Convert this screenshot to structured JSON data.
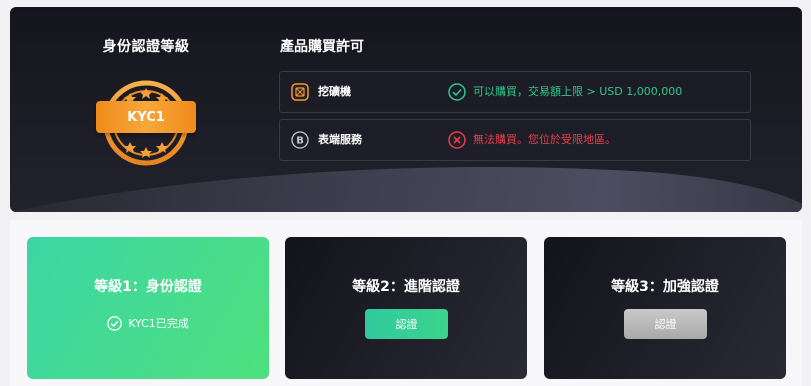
{
  "kyc": {
    "title": "身份認證等級",
    "badge_label": "KYC1"
  },
  "permissions": {
    "title": "產品購買許可",
    "items": [
      {
        "name": "挖礦機",
        "icon": "mining-machine-icon",
        "status": "ok",
        "status_icon": "check-circle-icon",
        "status_text": "可以購買，交易額上限 > USD 1,000,000"
      },
      {
        "name": "表端服務",
        "icon": "bitcoin-icon",
        "status": "blocked",
        "status_icon": "x-circle-icon",
        "status_text": "無法購買。您位於受限地區。"
      }
    ]
  },
  "levels": [
    {
      "title": "等級1：身份認證",
      "done_text": "KYC1已完成",
      "done_icon": "check-circle-icon"
    },
    {
      "title": "等級2：進階認證",
      "button_label": "認證"
    },
    {
      "title": "等級3：加強認證",
      "button_label": "認證"
    }
  ],
  "colors": {
    "success": "#2ec98a",
    "error": "#e5404a",
    "badge": "#f39a2a",
    "accent": "#3ad48d"
  }
}
